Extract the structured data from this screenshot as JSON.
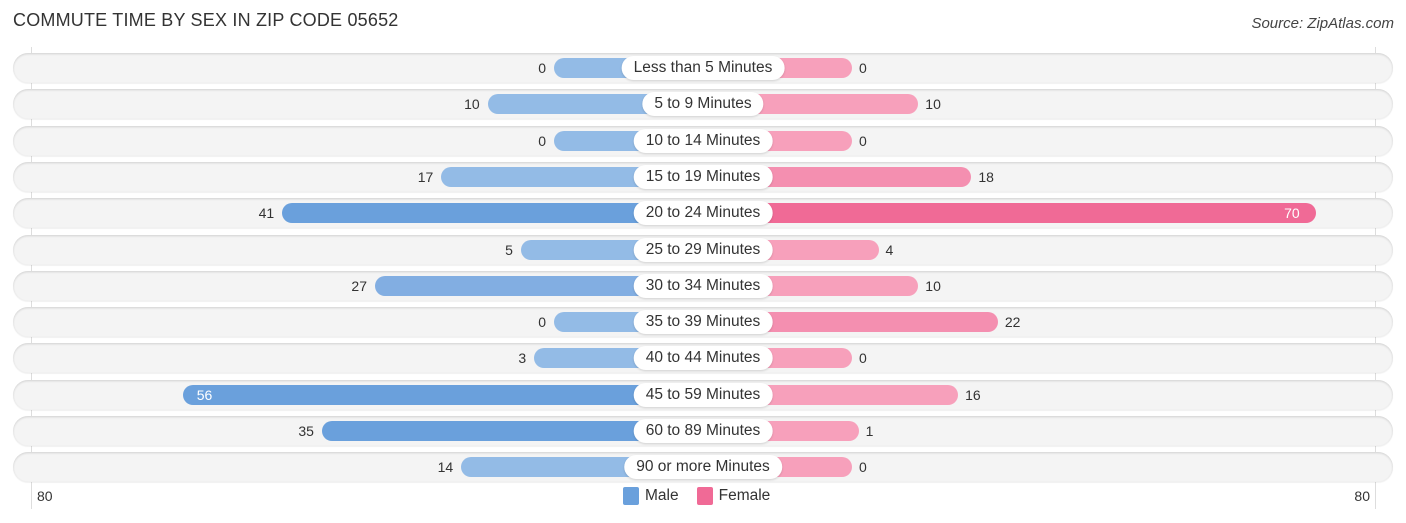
{
  "chart_data": {
    "type": "bar",
    "orientation": "horizontal-diverging",
    "title": "COMMUTE TIME BY SEX IN ZIP CODE 05652",
    "source": "Source: ZipAtlas.com",
    "categories": [
      "Less than 5 Minutes",
      "5 to 9 Minutes",
      "10 to 14 Minutes",
      "15 to 19 Minutes",
      "20 to 24 Minutes",
      "25 to 29 Minutes",
      "30 to 34 Minutes",
      "35 to 39 Minutes",
      "40 to 44 Minutes",
      "45 to 59 Minutes",
      "60 to 89 Minutes",
      "90 or more Minutes"
    ],
    "series": [
      {
        "name": "Male",
        "color": "#6aa0dc",
        "light_color": "#93bbe6",
        "side": "left",
        "values": [
          0,
          10,
          0,
          17,
          41,
          5,
          27,
          0,
          3,
          56,
          35,
          14
        ]
      },
      {
        "name": "Female",
        "color": "#f06a96",
        "light_color": "#f7a0bb",
        "side": "right",
        "values": [
          0,
          10,
          0,
          18,
          70,
          4,
          10,
          22,
          0,
          16,
          1,
          0
        ]
      }
    ],
    "axis": {
      "left_tick": "80",
      "right_tick": "80",
      "range": [
        -80,
        80
      ]
    },
    "legend": {
      "position": "bottom-center",
      "entries": [
        "Male",
        "Female"
      ]
    },
    "grid": false
  }
}
